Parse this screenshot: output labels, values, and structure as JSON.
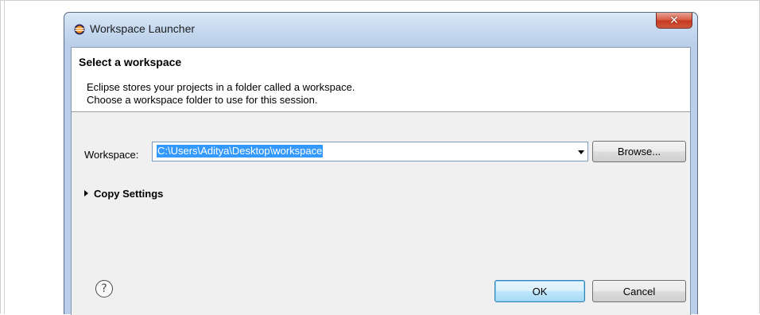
{
  "window": {
    "title": "Workspace Launcher",
    "close_icon": "close-icon",
    "app_icon": "eclipse-icon"
  },
  "header": {
    "title": "Select a workspace",
    "description_line1": "Eclipse stores your projects in a folder called a workspace.",
    "description_line2": "Choose a workspace folder to use for this session."
  },
  "workspace": {
    "label": "Workspace:",
    "value": "C:\\Users\\Aditya\\Desktop\\workspace",
    "dropdown_icon": "dropdown-arrow-icon",
    "browse_label": "Browse..."
  },
  "copy_settings": {
    "label": "Copy Settings",
    "expander_icon": "expand-arrow-icon"
  },
  "footer": {
    "help_icon": "help-icon",
    "help_glyph": "?",
    "ok_label": "OK",
    "cancel_label": "Cancel"
  },
  "colors": {
    "selection": "#3399ff",
    "close_button": "#c6391f",
    "titlebar": "#c7daf0"
  }
}
